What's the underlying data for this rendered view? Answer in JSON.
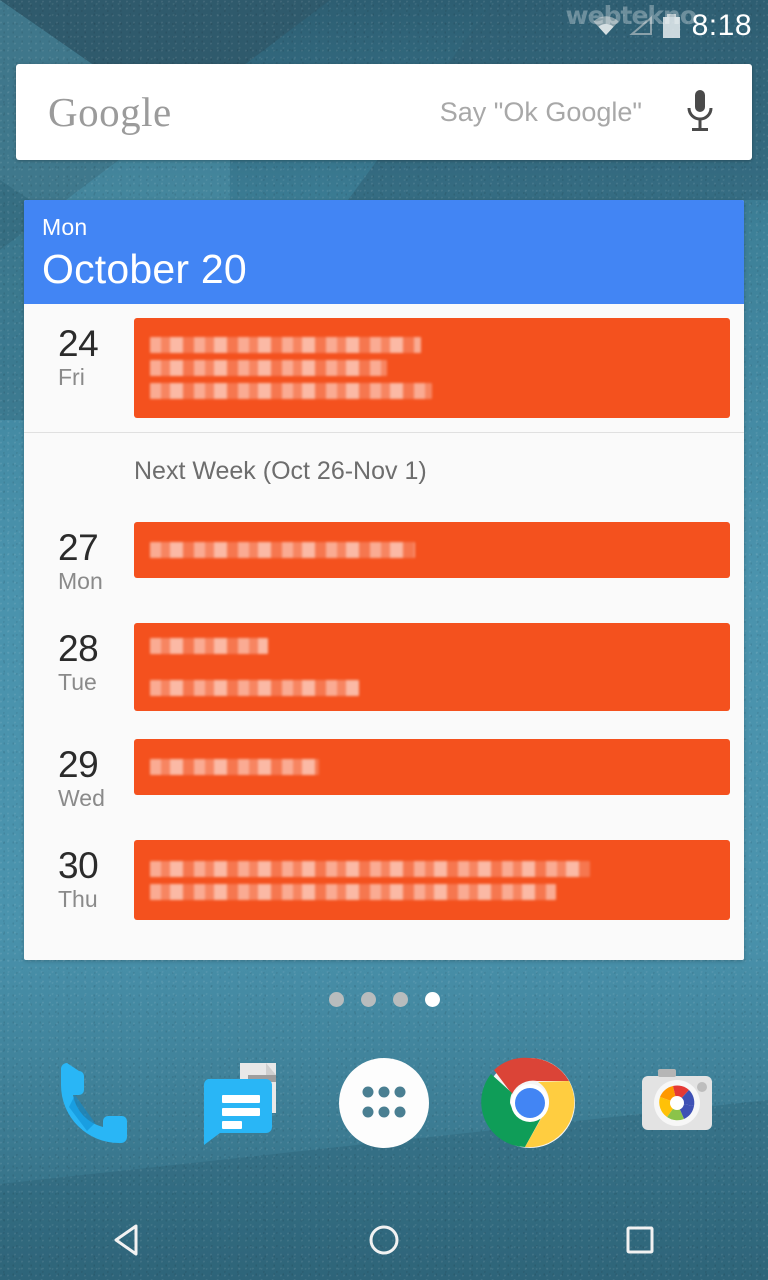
{
  "status_bar": {
    "clock": "8:18",
    "icons": [
      "wifi-icon",
      "signal-icon",
      "battery-icon"
    ],
    "watermark": "webtekno"
  },
  "search": {
    "logo_text": "Google",
    "placeholder": "Say \"Ok Google\"",
    "mic_icon": "microphone-icon"
  },
  "calendar_widget": {
    "header": {
      "day_of_week": "Mon",
      "date": "October 20",
      "accent_color": "#4285f4"
    },
    "event_color": "#f4511e",
    "sections": [
      {
        "label": null,
        "rows": [
          {
            "day_num": "24",
            "day_name": "Fri",
            "redacted_lines": 3
          }
        ]
      },
      {
        "label": "Next Week (Oct 26-Nov 1)",
        "rows": [
          {
            "day_num": "27",
            "day_name": "Mon",
            "redacted_lines": 1
          },
          {
            "day_num": "28",
            "day_name": "Tue",
            "redacted_lines": 2
          },
          {
            "day_num": "29",
            "day_name": "Wed",
            "redacted_lines": 1
          },
          {
            "day_num": "30",
            "day_name": "Thu",
            "redacted_lines": 2
          }
        ]
      }
    ]
  },
  "page_indicator": {
    "count": 4,
    "active_index": 3
  },
  "dock": {
    "items": [
      {
        "name": "phone-icon",
        "label": "Phone"
      },
      {
        "name": "messaging-icon",
        "label": "Messenger"
      },
      {
        "name": "app-drawer-icon",
        "label": "Apps"
      },
      {
        "name": "chrome-icon",
        "label": "Chrome"
      },
      {
        "name": "camera-icon",
        "label": "Camera"
      }
    ]
  },
  "nav_bar": {
    "buttons": [
      {
        "name": "back-button",
        "label": "Back"
      },
      {
        "name": "home-button",
        "label": "Home"
      },
      {
        "name": "recents-button",
        "label": "Recents"
      }
    ]
  },
  "colors": {
    "wallpaper_base": "#4a93ad",
    "widget_bg": "#fafafa",
    "accent_blue": "#4285f4",
    "event_orange": "#f4511e"
  }
}
